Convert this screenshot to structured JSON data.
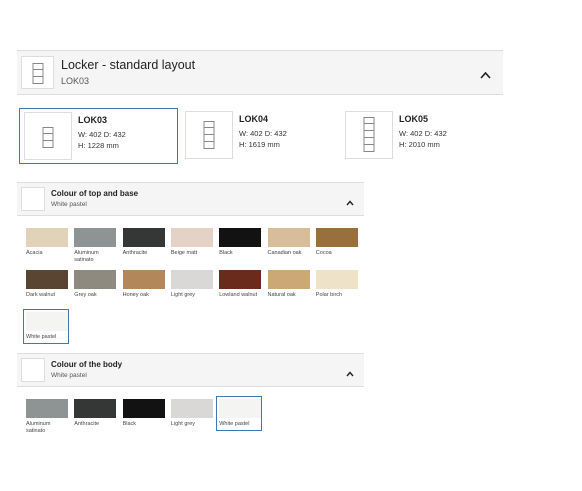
{
  "header": {
    "title": "Locker - standard layout",
    "subtitle": "LOK03",
    "icon": "chevron-up-icon"
  },
  "lockers": [
    {
      "name": "LOK03",
      "wd": "W: 402 D: 432",
      "h": "H: 1228 mm",
      "selected": true
    },
    {
      "name": "LOK04",
      "wd": "W: 402 D: 432",
      "h": "H: 1619 mm",
      "selected": false
    },
    {
      "name": "LOK05",
      "wd": "W: 402 D: 432",
      "h": "H: 2010 mm",
      "selected": false
    }
  ],
  "top_base": {
    "title": "Colour of top and base",
    "value": "White pastel",
    "swatches": [
      {
        "label": "Acacia",
        "color": "#e0d3ba"
      },
      {
        "label": "Aluminum satinato",
        "color": "#8e9393"
      },
      {
        "label": "Anthracite",
        "color": "#353636"
      },
      {
        "label": "Beige matt",
        "color": "#e4d2c7"
      },
      {
        "label": "Black",
        "color": "#121212"
      },
      {
        "label": "Canadian oak",
        "color": "#d7bd99"
      },
      {
        "label": "Cocoa",
        "color": "#9a6f3e"
      },
      {
        "label": "Dark walnut",
        "color": "#5a4532"
      },
      {
        "label": "Grey oak",
        "color": "#8f8a80"
      },
      {
        "label": "Honey oak",
        "color": "#b2875a"
      },
      {
        "label": "Light grey",
        "color": "#d9d8d6"
      },
      {
        "label": "Lowland walnut",
        "color": "#6a2b1c"
      },
      {
        "label": "Natural oak",
        "color": "#cca876"
      },
      {
        "label": "Polar birch",
        "color": "#eee3c8"
      },
      {
        "label": "White pastel",
        "color": "#f4f4f3",
        "selected": true
      }
    ]
  },
  "body": {
    "title": "Colour of the body",
    "value": "White pastel",
    "swatches": [
      {
        "label": "Aluminum satinato",
        "color": "#8e9393"
      },
      {
        "label": "Anthracite",
        "color": "#353636"
      },
      {
        "label": "Black",
        "color": "#121212"
      },
      {
        "label": "Light grey",
        "color": "#d9d8d6"
      },
      {
        "label": "White pastel",
        "color": "#f4f4f3",
        "selected": true
      }
    ]
  }
}
